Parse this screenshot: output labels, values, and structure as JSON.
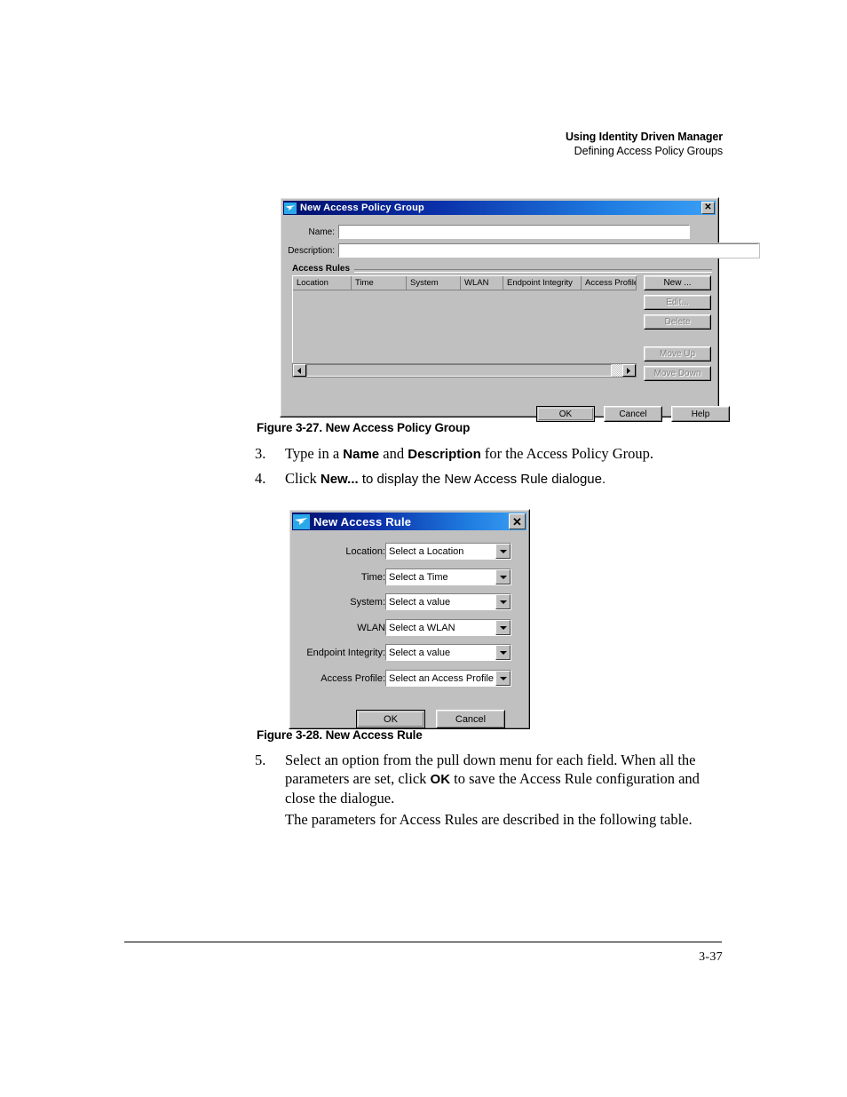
{
  "header": {
    "line1": "Using Identity Driven Manager",
    "line2": "Defining Access Policy Groups"
  },
  "dialog_access_policy_group": {
    "title": "New Access Policy Group",
    "close_label": "✕",
    "fields": {
      "name_label": "Name:",
      "name_value": "",
      "description_label": "Description:",
      "description_value": ""
    },
    "group_title": "Access Rules",
    "table_headers": [
      "Location",
      "Time",
      "System",
      "WLAN",
      "Endpoint Integrity",
      "Access Profile"
    ],
    "side_buttons": [
      {
        "label": "New ...",
        "enabled": true
      },
      {
        "label": "Edit...",
        "enabled": false
      },
      {
        "label": "Delete",
        "enabled": false
      },
      {
        "label": "Move Up",
        "enabled": false
      },
      {
        "label": "Move Down",
        "enabled": false
      }
    ],
    "scrollbar": {
      "left_arrow": "◀",
      "right_arrow": "▶"
    },
    "footer_buttons": [
      "OK",
      "Cancel",
      "Help"
    ]
  },
  "dialog_access_rule": {
    "title": "New Access Rule",
    "close_label": "✕",
    "rows": [
      {
        "label": "Location:",
        "value": "Select a Location"
      },
      {
        "label": "Time:",
        "value": "Select a Time"
      },
      {
        "label": "System:",
        "value": "Select a value"
      },
      {
        "label": "WLAN",
        "value": "Select a WLAN"
      },
      {
        "label": "Endpoint Integrity:",
        "value": "Select a value"
      },
      {
        "label": "Access Profile:",
        "value": "Select an Access Profile"
      }
    ],
    "footer_buttons": [
      "OK",
      "Cancel"
    ]
  },
  "captions": {
    "figure_327": "Figure 3-27. New Access Policy Group",
    "figure_328": "Figure 3-28. New Access Rule"
  },
  "steps": {
    "step3": {
      "number": "3.",
      "part1": "Type in a ",
      "bold1": "Name",
      "part2": " and ",
      "bold2": "Description",
      "part3": " for the Access Policy Group."
    },
    "step4": {
      "number": "4.",
      "part1": "Click ",
      "bold1": "New...",
      "part2": " to display the New Access Rule dialogue."
    },
    "step5": {
      "number": "5.",
      "part1": "Select an option from the pull down menu for each field. When all the parameters are set, click ",
      "bold1": "OK",
      "part2": " to save the Access Rule configuration and close the dialogue."
    },
    "paragraph_follow": "The parameters for Access Rules are described in the following table."
  },
  "page_number": "3-37"
}
